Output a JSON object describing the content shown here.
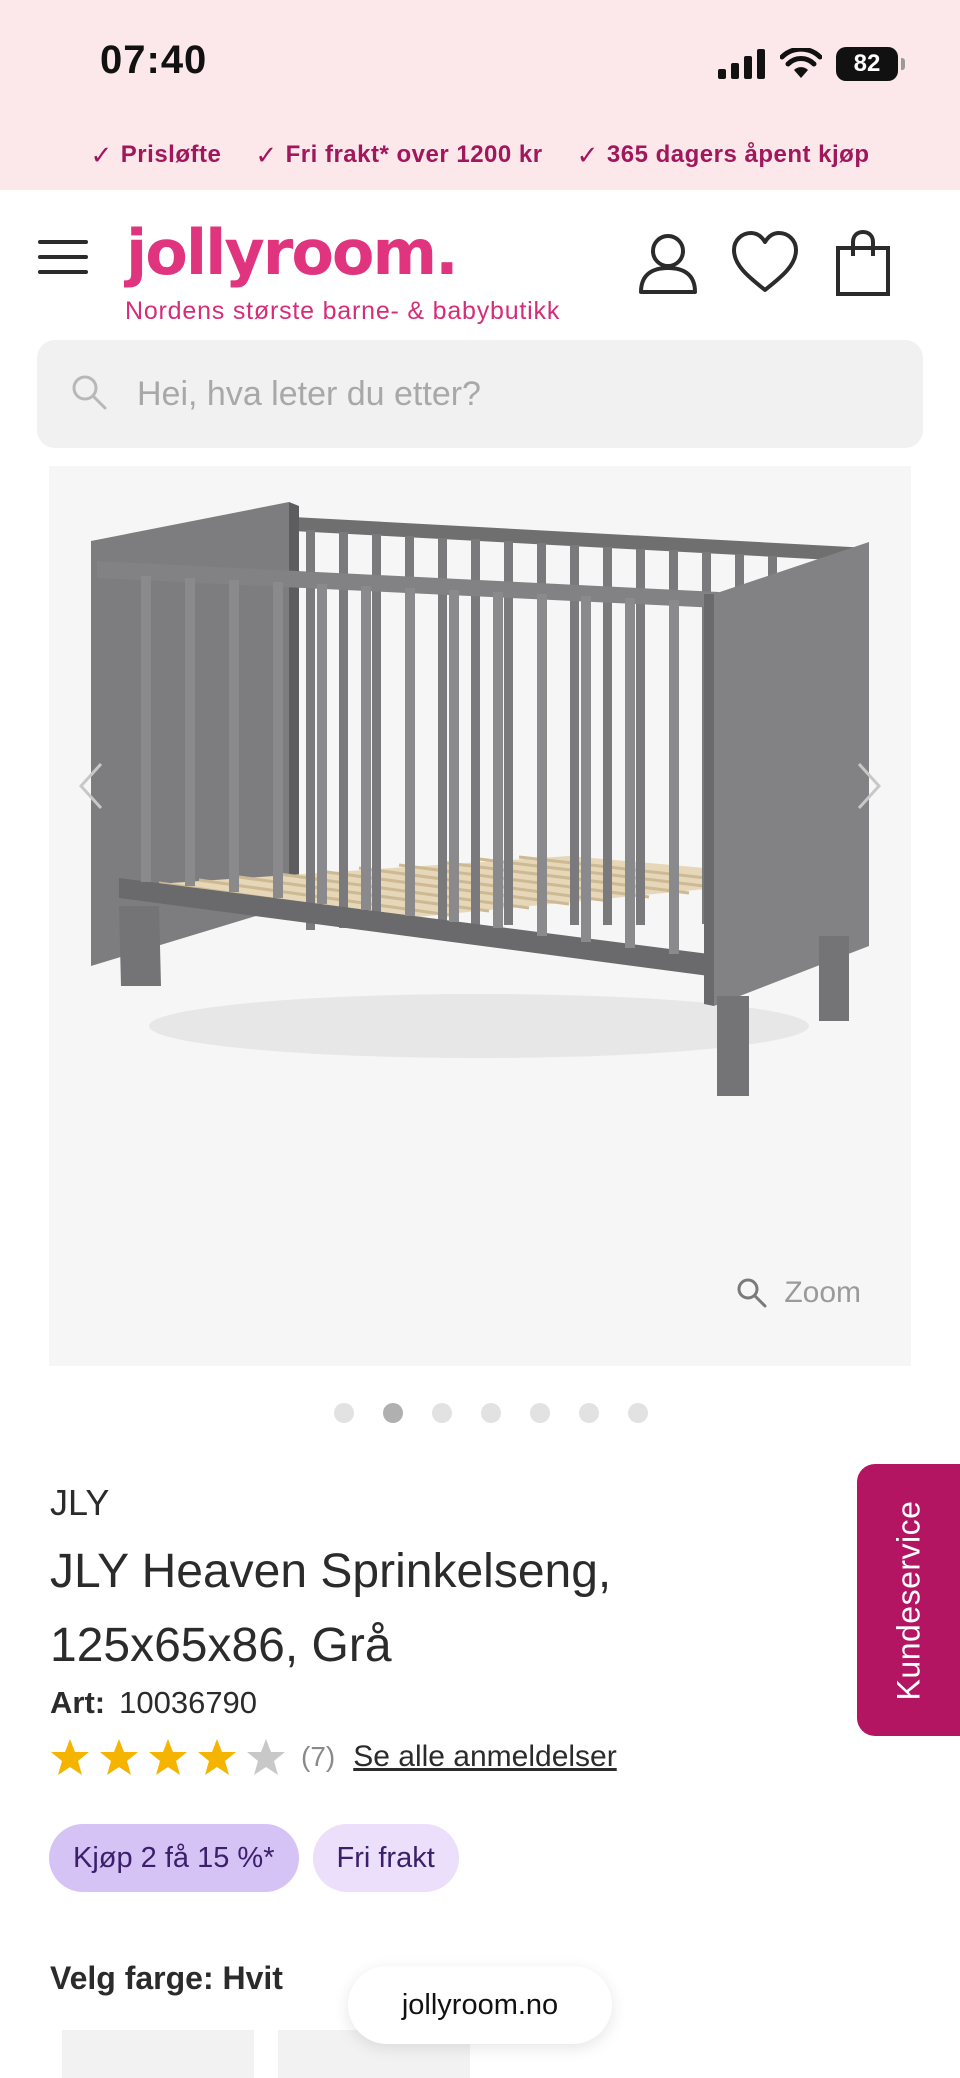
{
  "status_bar": {
    "time": "07:40",
    "battery": "82",
    "icons": [
      "cellular-signal-icon",
      "wifi-icon",
      "battery-icon"
    ]
  },
  "usp_bar": {
    "items": [
      "Prisløfte",
      "Fri frakt* over 1200 kr",
      "365 dagers åpent kjøp"
    ],
    "color": "#a0175b"
  },
  "header": {
    "logo": "jollyroom.",
    "tagline": "Nordens største barne- & babybutikk",
    "brand_color": "#e0347e",
    "icons": [
      "menu-icon",
      "account-icon",
      "heart-icon",
      "shopping-bag-icon"
    ]
  },
  "search": {
    "placeholder": "Hei, hva leter du etter?",
    "value": ""
  },
  "gallery": {
    "zoom_label": "Zoom",
    "image_count": 7,
    "active_index": 2
  },
  "product": {
    "brand": "JLY",
    "title": "JLY Heaven Sprinkelseng, 125x65x86, Grå",
    "art_label": "Art:",
    "art_number": "10036790",
    "rating": 4,
    "rating_max": 5,
    "review_count": "(7)",
    "all_reviews_link": "Se alle anmeldelser",
    "badges": [
      "Kjøp 2 få 15 %*",
      "Fri frakt"
    ],
    "color_label": "Velg farge: Hvit"
  },
  "side_tab": {
    "label": "Kundeservice",
    "color": "#b31563"
  },
  "browser": {
    "url": "jollyroom.no"
  }
}
